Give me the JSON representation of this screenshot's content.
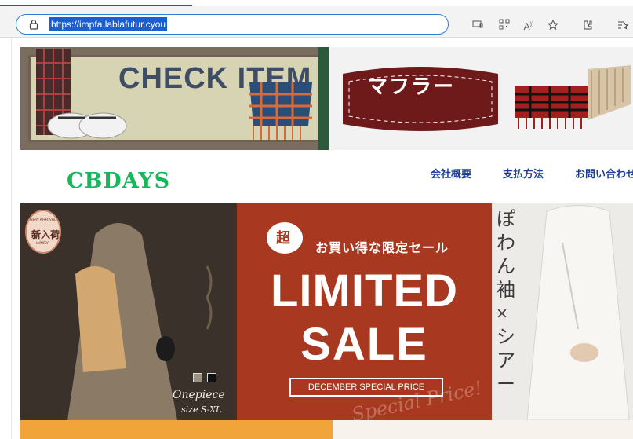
{
  "browser": {
    "url": "https://impfa.lablafutur.cyou",
    "icons": [
      "app-available-icon",
      "qr-code-icon",
      "read-aloud-icon",
      "favorite-icon",
      "extensions-icon",
      "collections-icon"
    ]
  },
  "site": {
    "top_banner": {
      "left_text": "CHECK ITEM",
      "right_text": "マフラー"
    },
    "logo": "CBDAYS",
    "nav": [
      "会社概要",
      "支払方法",
      "お問い合わせ"
    ],
    "hero": {
      "badge_top": "NEW ARRIVAL",
      "badge_main": "新入荷",
      "badge_bottom": "winter",
      "onepiece": "Onepiece",
      "size": "size S-XL",
      "chou": "超",
      "subtitle": "お買い得な限定セール",
      "line1": "LIMITED",
      "line2": "SALE",
      "price_label": "DECEMBER SPECIAL PRICE",
      "script_text": "Special Price!",
      "vertical_text": "ぽわん袖×シアー"
    }
  },
  "colors": {
    "logo": "#16b85a",
    "nav": "#1c3f9a",
    "sale_bg": "#a8381f",
    "url_highlight": "#1b5ecf"
  }
}
